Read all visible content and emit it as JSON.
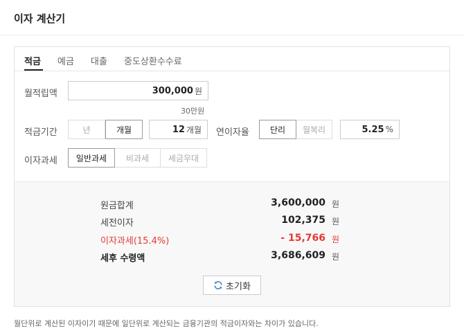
{
  "page_title": "이자 계산기",
  "tabs": [
    "적금",
    "예금",
    "대출",
    "중도상환수수료"
  ],
  "monthly_deposit": {
    "label": "월적립액",
    "value": "300,000",
    "unit": "원",
    "hint": "30만원"
  },
  "period": {
    "label": "적금기간",
    "options": [
      "년",
      "개월"
    ],
    "value": "12",
    "unit": "개월"
  },
  "interest_rate": {
    "label": "연이자율",
    "options": [
      "단리",
      "월복리"
    ],
    "value": "5.25",
    "unit": "%"
  },
  "taxation": {
    "label": "이자과세",
    "options": [
      "일반과세",
      "비과세",
      "세금우대"
    ]
  },
  "results": {
    "principal": {
      "label": "원금합계",
      "value": "3,600,000",
      "unit": "원"
    },
    "pre_tax_interest": {
      "label": "세전이자",
      "value": "102,375",
      "unit": "원"
    },
    "tax": {
      "label": "이자과세(15.4%)",
      "value": "- 15,766",
      "unit": "원"
    },
    "after_tax": {
      "label": "세후 수령액",
      "value": "3,686,609",
      "unit": "원"
    }
  },
  "reset_label": "초기화",
  "notice": "월단위로 계산된 이자이기 때문에 일단위로 계산되는 금융기관의 적금이자와는 차이가 있습니다.",
  "colors": {
    "accent_red": "#e53935",
    "result_bg": "#f8f8f8"
  }
}
